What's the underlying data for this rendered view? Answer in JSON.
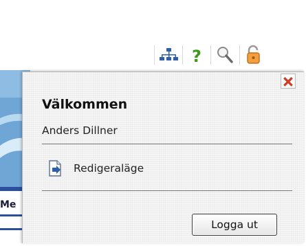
{
  "toolbar": {
    "icons": [
      {
        "name": "sitemap-icon",
        "color": "#2f5fa8"
      },
      {
        "name": "help-icon",
        "color": "#3f9a1a"
      },
      {
        "name": "search-icon",
        "color": "#8a8a8a"
      },
      {
        "name": "lock-icon",
        "color": "#e08a2a"
      }
    ]
  },
  "background": {
    "menu_label": "Me"
  },
  "popup": {
    "title": "Välkommen",
    "user_name": "Anders Dillner",
    "edit_mode_label": "Redigeraläge",
    "edit_mode_icon": "edit-document-icon",
    "close_icon": "close-icon",
    "logout_label": "Logga ut"
  },
  "colors": {
    "panel_bg": "#f1f1f1",
    "close_red": "#e03a1f",
    "accent_blue": "#2f5fa8"
  }
}
